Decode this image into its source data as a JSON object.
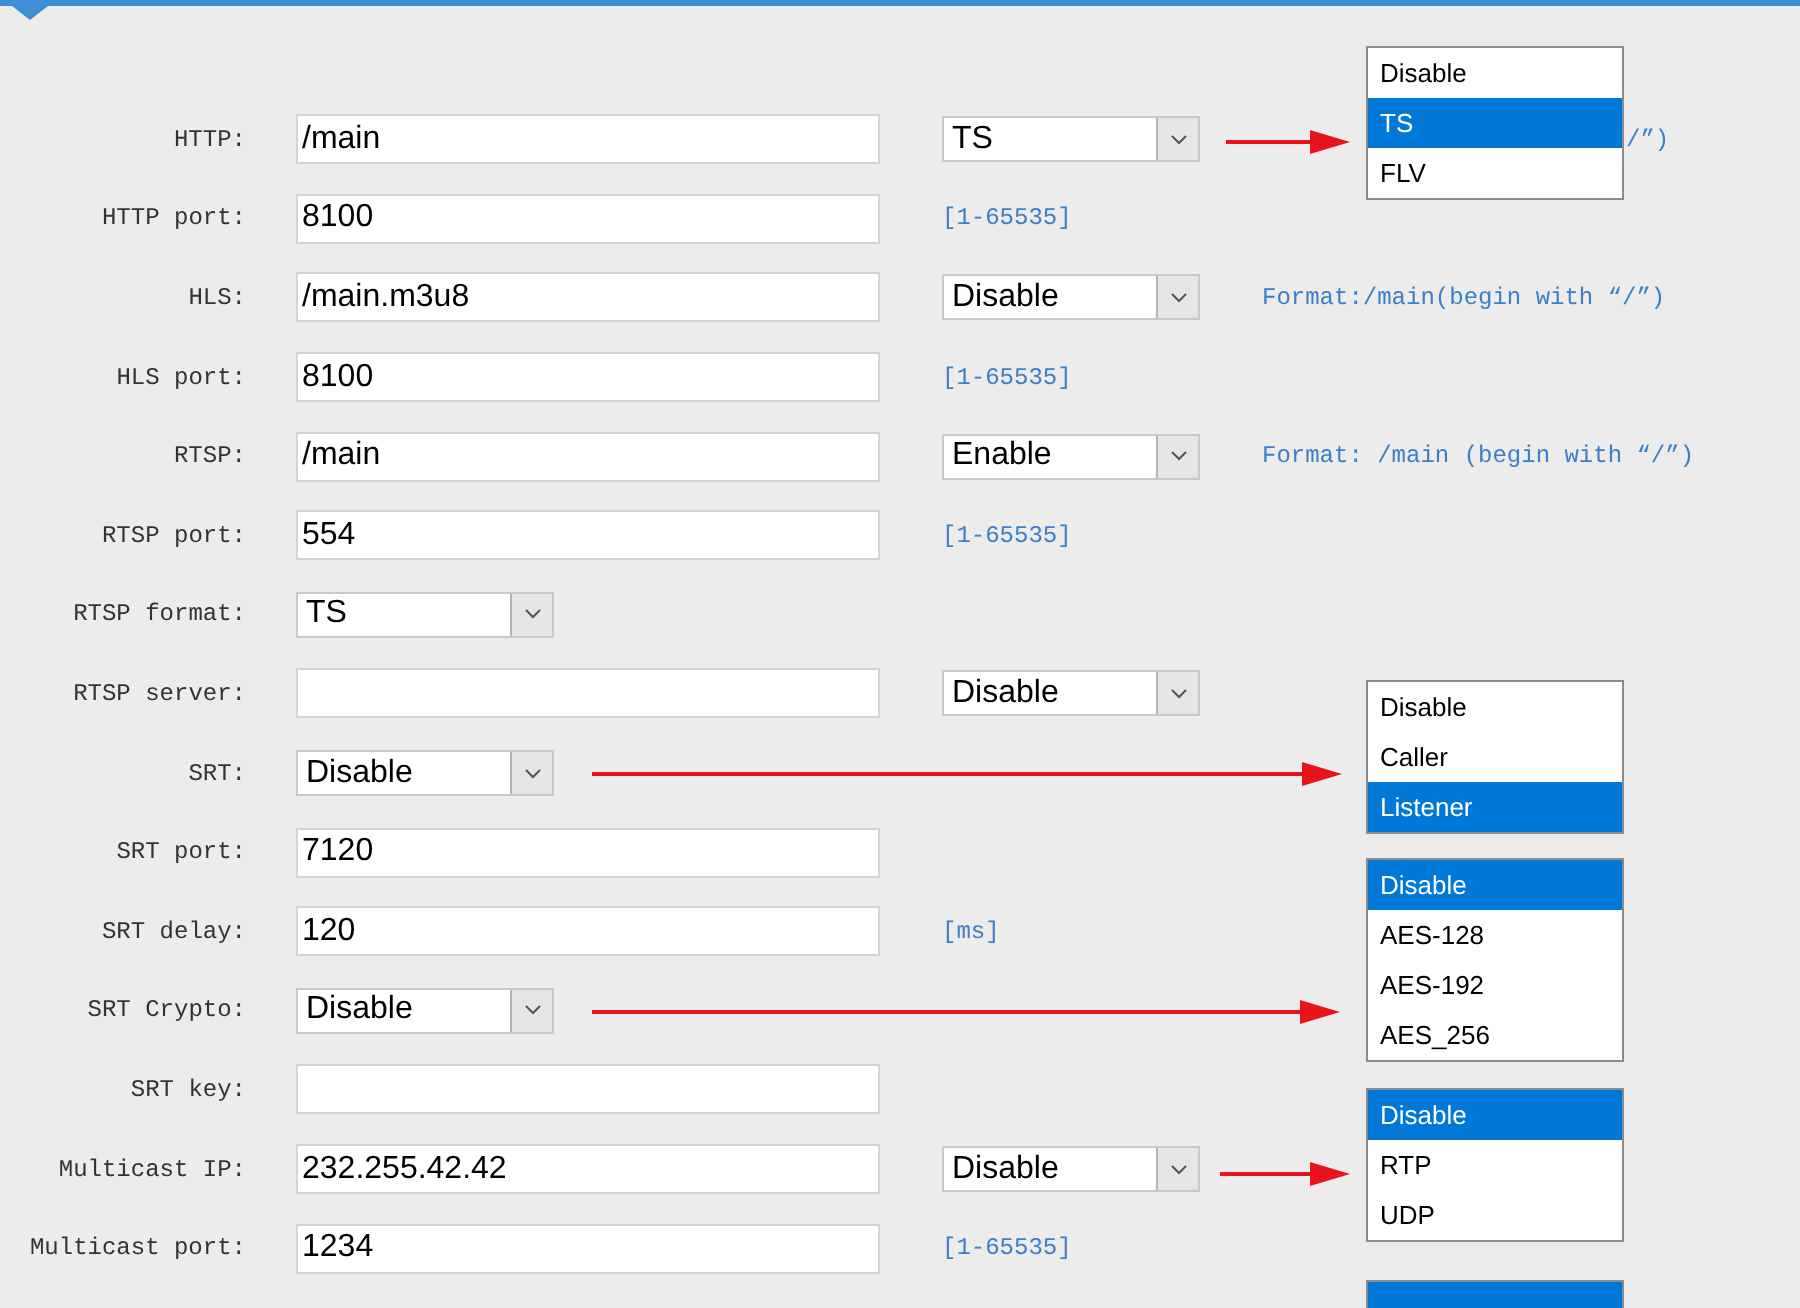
{
  "rows": [
    {
      "label": "HTTP:",
      "field": {
        "kind": "input",
        "value": "/main"
      },
      "select": {
        "value": "TS"
      },
      "hint_tail": "/”)"
    },
    {
      "label": "HTTP port:",
      "field": {
        "kind": "input",
        "value": "8100"
      },
      "hint": "[1-65535]"
    },
    {
      "label": "HLS:",
      "field": {
        "kind": "input",
        "value": "/main.m3u8"
      },
      "select": {
        "value": "Disable"
      },
      "hint": "Format:/main(begin with “/”)"
    },
    {
      "label": "HLS port:",
      "field": {
        "kind": "input",
        "value": "8100"
      },
      "hint": "[1-65535]"
    },
    {
      "label": "RTSP:",
      "field": {
        "kind": "input",
        "value": "/main"
      },
      "select": {
        "value": "Enable"
      },
      "hint": "Format: /main (begin with “/”)"
    },
    {
      "label": "RTSP port:",
      "field": {
        "kind": "input",
        "value": "554"
      },
      "hint": "[1-65535]"
    },
    {
      "label": "RTSP format:",
      "field": {
        "kind": "select",
        "value": "TS"
      }
    },
    {
      "label": "RTSP server:",
      "field": {
        "kind": "input"
      },
      "select": {
        "value": "Disable"
      }
    },
    {
      "label": "SRT:",
      "field": {
        "kind": "select",
        "value": "Disable"
      }
    },
    {
      "label": "SRT port:",
      "field": {
        "kind": "input",
        "value": "7120"
      }
    },
    {
      "label": "SRT delay:",
      "field": {
        "kind": "input",
        "value": "120"
      },
      "hint": "[ms]"
    },
    {
      "label": "SRT Crypto:",
      "field": {
        "kind": "select",
        "value": "Disable"
      }
    },
    {
      "label": "SRT key:",
      "field": {
        "kind": "input"
      }
    },
    {
      "label": "Multicast IP:",
      "field": {
        "kind": "input",
        "value": "232.255.42.42"
      },
      "select": {
        "value": "Disable"
      }
    },
    {
      "label": "Multicast port:",
      "field": {
        "kind": "input",
        "value": "1234"
      },
      "hint": "[1-65535]"
    }
  ],
  "option_lists": [
    {
      "options": [
        {
          "label": "Disable",
          "selected": false
        },
        {
          "label": "TS",
          "selected": true
        },
        {
          "label": "FLV",
          "selected": false
        }
      ]
    },
    {
      "options": [
        {
          "label": "Disable",
          "selected": false
        },
        {
          "label": "Caller",
          "selected": false
        },
        {
          "label": "Listener",
          "selected": true
        }
      ]
    },
    {
      "options": [
        {
          "label": "Disable",
          "selected": true
        },
        {
          "label": "AES-128",
          "selected": false
        },
        {
          "label": "AES-192",
          "selected": false
        },
        {
          "label": "AES_256",
          "selected": false
        }
      ]
    },
    {
      "options": [
        {
          "label": "Disable",
          "selected": true
        },
        {
          "label": "RTP",
          "selected": false
        },
        {
          "label": "UDP",
          "selected": false
        }
      ]
    },
    {
      "options": [
        {
          "selected": true
        }
      ]
    }
  ]
}
